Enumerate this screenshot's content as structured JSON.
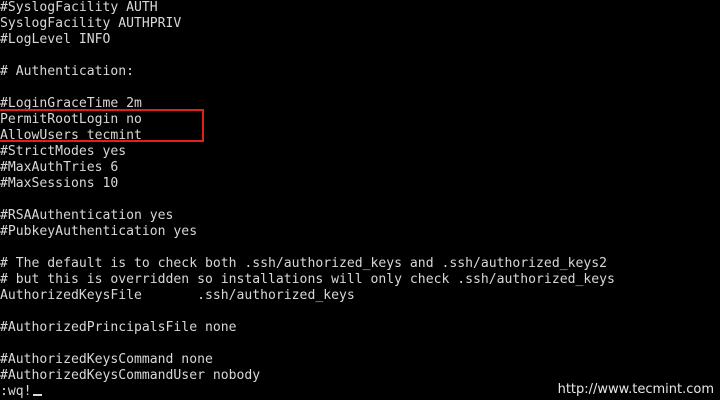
{
  "terminal": {
    "lines": [
      "#SyslogFacility AUTH",
      "SyslogFacility AUTHPRIV",
      "#LogLevel INFO",
      "",
      "# Authentication:",
      "",
      "#LoginGraceTime 2m",
      "PermitRootLogin no",
      "AllowUsers tecmint",
      "#StrictModes yes",
      "#MaxAuthTries 6",
      "#MaxSessions 10",
      "",
      "#RSAAuthentication yes",
      "#PubkeyAuthentication yes",
      "",
      "# The default is to check both .ssh/authorized_keys and .ssh/authorized_keys2",
      "# but this is overridden so installations will only check .ssh/authorized_keys",
      "AuthorizedKeysFile       .ssh/authorized_keys",
      "",
      "#AuthorizedPrincipalsFile none",
      "",
      "#AuthorizedKeysCommand none",
      "#AuthorizedKeysCommandUser nobody"
    ],
    "command_line": ":wq!",
    "text_color": "#d8d8d8",
    "background_color": "#000000",
    "highlight_color": "#e01f1f"
  },
  "watermark": {
    "text": "http://www.tecmint.com"
  }
}
